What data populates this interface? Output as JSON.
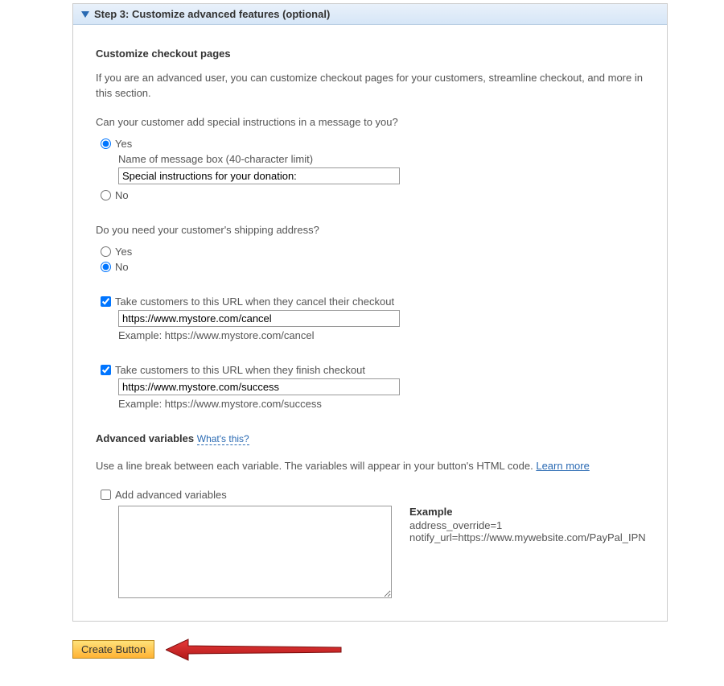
{
  "header": {
    "title": "Step 3: Customize advanced features (optional)"
  },
  "customize": {
    "heading": "Customize checkout pages",
    "intro": "If you are an advanced user, you can customize checkout pages for your customers, streamline checkout, and more in this section."
  },
  "special_instructions": {
    "question": "Can your customer add special instructions in a message to you?",
    "yes_label": "Yes",
    "no_label": "No",
    "sub_label": "Name of message box (40-character limit)",
    "sub_value": "Special instructions for your donation:"
  },
  "shipping": {
    "question": "Do you need your customer's shipping address?",
    "yes_label": "Yes",
    "no_label": "No"
  },
  "cancel_url": {
    "label": "Take customers to this URL when they cancel their checkout",
    "value": "https://www.mystore.com/cancel",
    "example": "Example: https://www.mystore.com/cancel"
  },
  "finish_url": {
    "label": "Take customers to this URL when they finish checkout",
    "value": "https://www.mystore.com/success",
    "example": "Example: https://www.mystore.com/success"
  },
  "advanced": {
    "heading": "Advanced variables",
    "whats_this": "What's this?",
    "desc_prefix": "Use a line break between each variable. The variables will appear in your button's HTML code. ",
    "learn_more": "Learn more",
    "add_label": "Add advanced variables",
    "example_title": "Example",
    "example_line1": "address_override=1",
    "example_line2": "notify_url=https://www.mywebsite.com/PayPal_IPN"
  },
  "footer": {
    "create_label": "Create Button"
  }
}
